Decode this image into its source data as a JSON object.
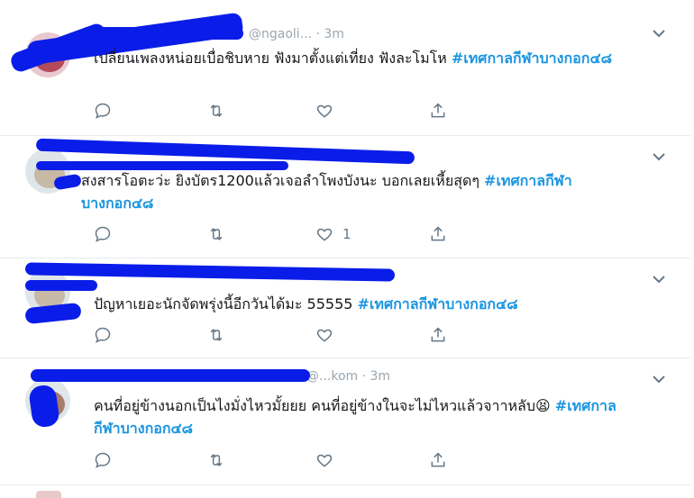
{
  "tweets": [
    {
      "handle_ghost": "@ngaoli... · 3m",
      "text": "เปลี่ยนเพลงหน่อยเบื่อชิบหาย ฟังมาตั้งแต่เที่ยง ฟังละโมโห ",
      "hashtag": "#เทศกาลกีฬาบางกอก๔๘",
      "likes": ""
    },
    {
      "handle_ghost": "",
      "text": "สงสารโอตะว่ะ ยิงบัตร1200แล้วเจอลำโพงบังนะ บอกเลยเหี้ยสุดๆ ",
      "hashtag": "#เทศกาลกีฬาบางกอก๔๘",
      "likes": "1"
    },
    {
      "handle_ghost": "",
      "text": "ปัญหาเยอะนักจัดพรุ่งนี้อีกวันได้มะ 55555 ",
      "hashtag": "#เทศกาลกีฬาบางกอก๔๘",
      "likes": ""
    },
    {
      "handle_ghost": "@...kom · 3m",
      "text": "คนที่อยู่ข้างนอกเป็นไงมั่งไหวมั้ยยย คนที่อยู่ข้างในจะไม่ไหวแล้วจาาหลับ😫 ",
      "hashtag": "#เทศกาลกีฬาบางกอก๔๘",
      "likes": ""
    }
  ],
  "icons": {
    "reply": "reply-icon",
    "retweet": "retweet-icon",
    "like": "heart-icon",
    "share": "share-icon",
    "caret": "chevron-down-icon"
  },
  "colors": {
    "hashtag": "#1b95e0",
    "redaction": "#0a1de8",
    "icon": "#657786",
    "divider": "#e6ecf0"
  }
}
